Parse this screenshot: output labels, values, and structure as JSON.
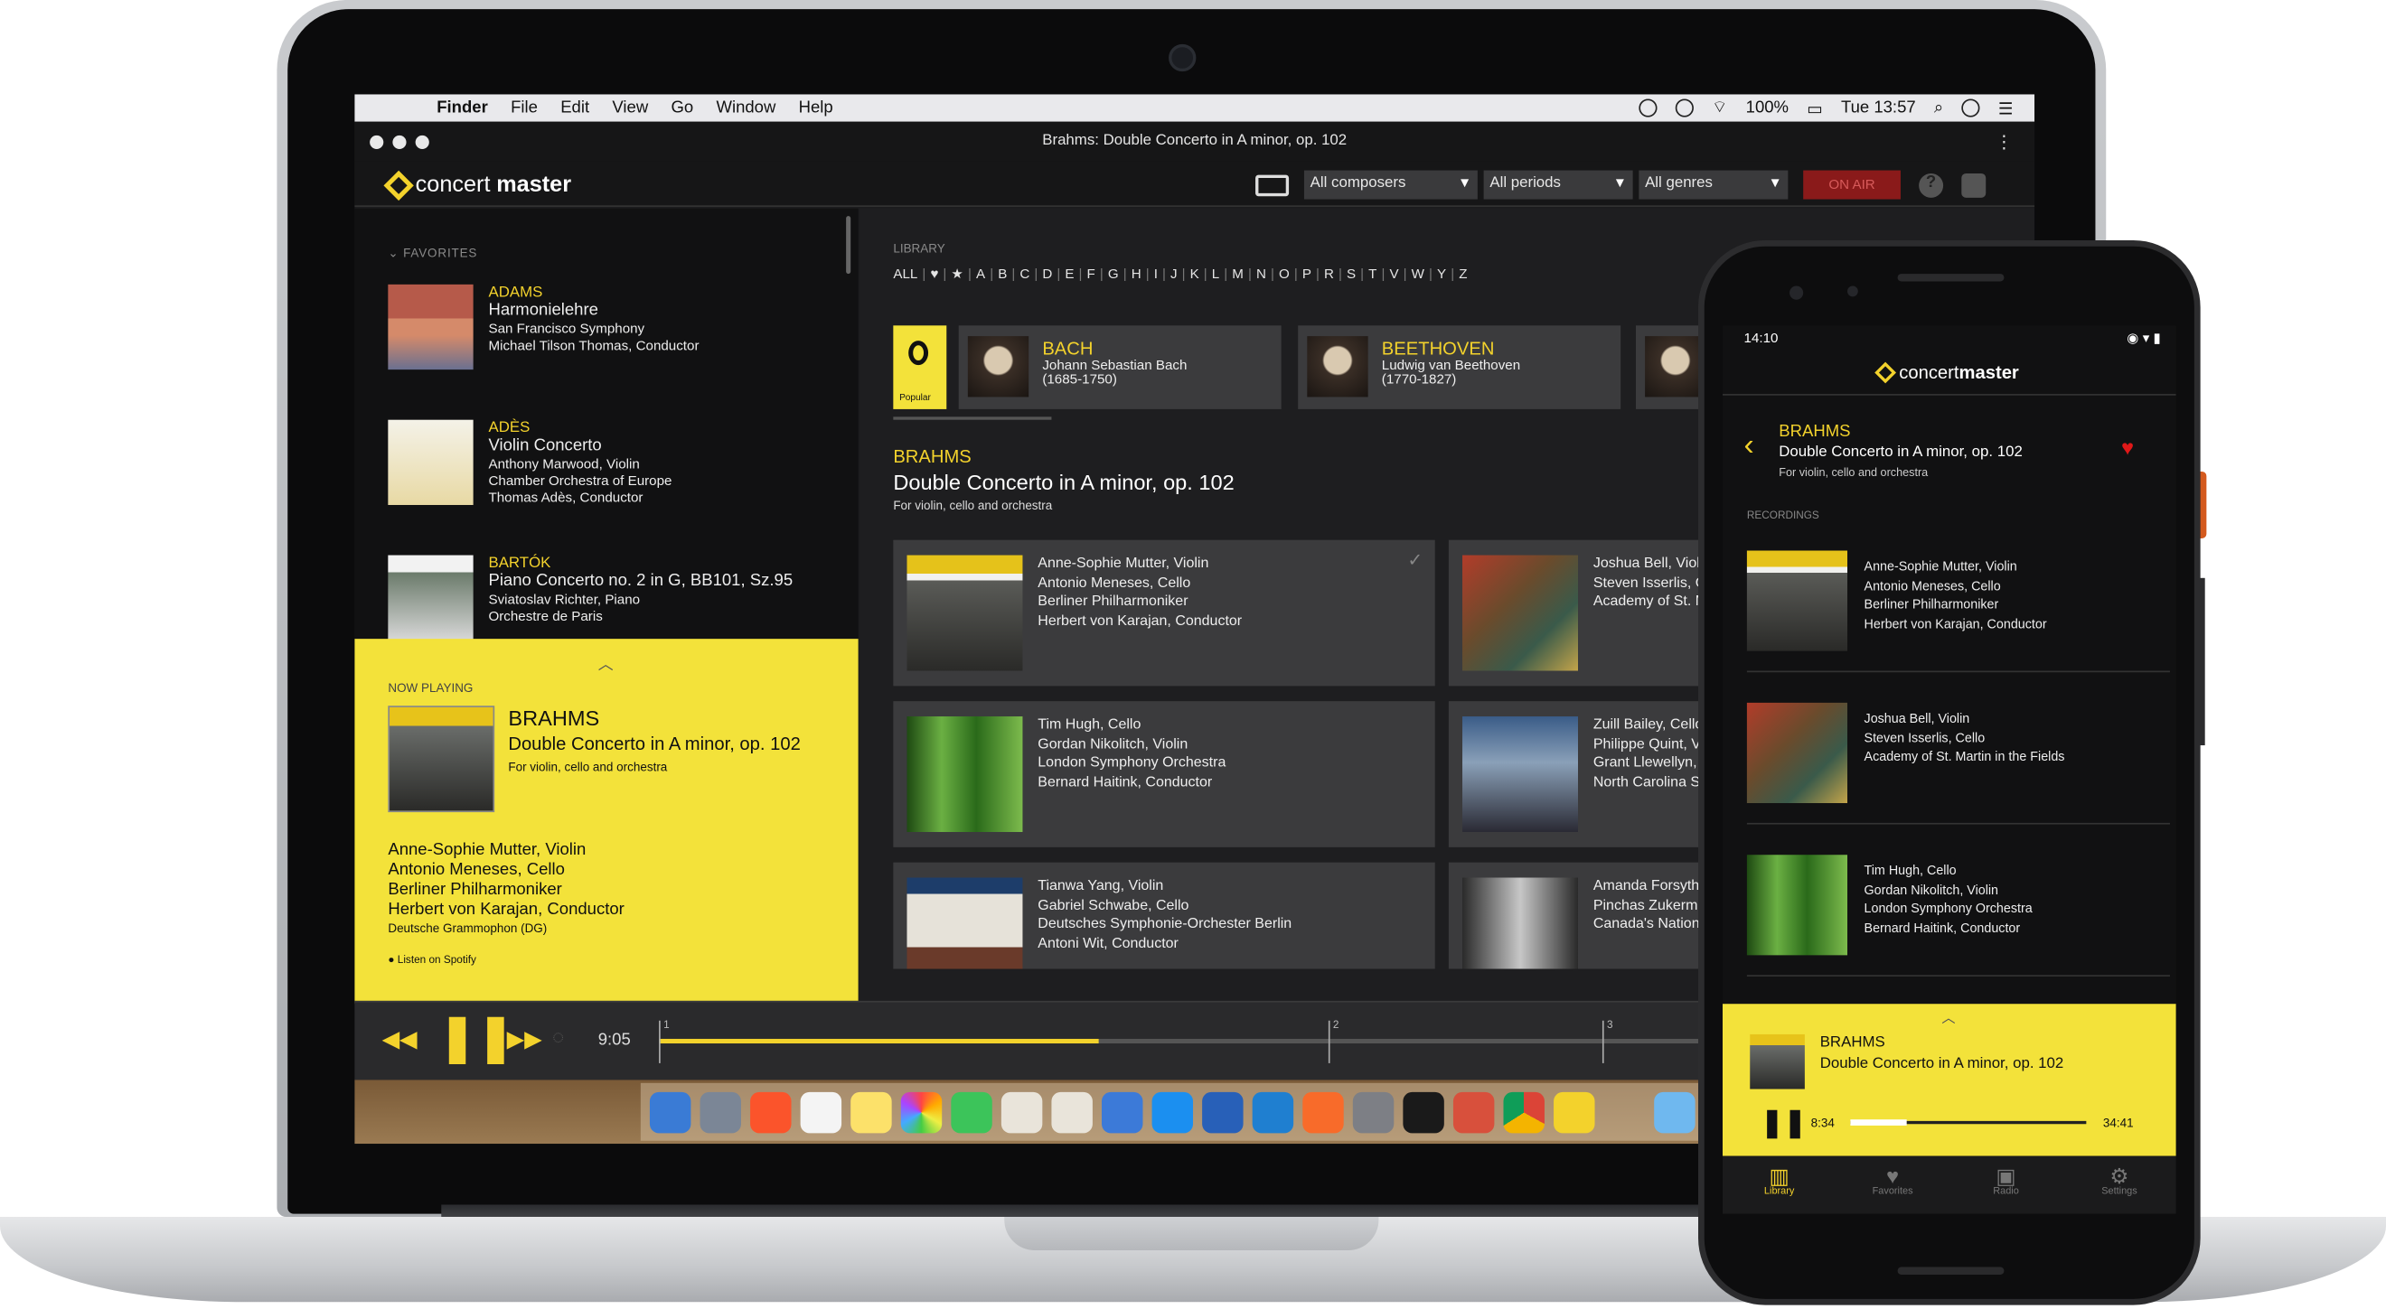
{
  "mac_menubar": {
    "items": [
      "Finder",
      "File",
      "Edit",
      "View",
      "Go",
      "Window",
      "Help"
    ],
    "battery": "100%",
    "clock": "Tue 13:57"
  },
  "window": {
    "title": "Brahms: Double Concerto in A minor, op. 102"
  },
  "app": {
    "logo_light": "concert",
    "logo_bold": "master",
    "filters": [
      "All composers",
      "All periods",
      "All genres"
    ],
    "on_air": "ON AIR",
    "help": "?"
  },
  "favorites": {
    "label": "FAVORITES",
    "items": [
      {
        "composer": "ADAMS",
        "work": "Harmonielehre",
        "performers": [
          "San Francisco Symphony",
          "Michael Tilson Thomas, Conductor"
        ]
      },
      {
        "composer": "ADÈS",
        "work": "Violin Concerto",
        "performers": [
          "Anthony Marwood, Violin",
          "Chamber Orchestra of Europe",
          "Thomas Adès, Conductor"
        ]
      },
      {
        "composer": "BARTÓK",
        "work": "Piano Concerto no. 2 in G, BB101, Sz.95",
        "performers": [
          "Sviatoslav Richter, Piano",
          "Orchestre de Paris"
        ]
      }
    ]
  },
  "now_playing": {
    "label": "NOW PLAYING",
    "composer": "BRAHMS",
    "work": "Double Concerto in A minor, op. 102",
    "subtitle": "For violin, cello and orchestra",
    "performers": [
      {
        "name": "Anne-Sophie Mutter",
        "role": ", Violin"
      },
      {
        "name": "Antonio Meneses",
        "role": ", Cello"
      },
      {
        "name": "Berliner Philharmoniker",
        "role": ""
      },
      {
        "name": "Herbert von Karajan",
        "role": ", Conductor"
      }
    ],
    "label_name": "Deutsche Grammophon (DG)",
    "spotify": "Listen on Spotify"
  },
  "player": {
    "time": "9:05",
    "progress_fraction": 0.32,
    "movements": [
      "1",
      "2",
      "3"
    ]
  },
  "library": {
    "label": "LIBRARY",
    "alphabet": [
      "ALL",
      "♥",
      "★",
      "A",
      "B",
      "C",
      "D",
      "E",
      "F",
      "G",
      "H",
      "I",
      "J",
      "K",
      "L",
      "M",
      "N",
      "O",
      "P",
      "R",
      "S",
      "T",
      "V",
      "W",
      "Y",
      "Z"
    ],
    "popular_label": "Popular",
    "composers": [
      {
        "name": "BACH",
        "full": "Johann Sebastian Bach",
        "dates": "(1685-1750)"
      },
      {
        "name": "BEETHOVEN",
        "full": "Ludwig van Beethoven",
        "dates": "(1770-1827)"
      }
    ],
    "work": {
      "composer": "BRAHMS",
      "title": "Double Concerto in A minor, op. 102",
      "subtitle": "For violin, cello and orchestra"
    },
    "recordings": [
      [
        "Anne-Sophie Mutter, Violin",
        "Antonio Meneses, Cello",
        "Berliner Philharmoniker",
        "Herbert von Karajan, Conductor"
      ],
      [
        "Joshua Bell, Violin",
        "Steven Isserlis, Cello",
        "Academy of St. M"
      ],
      [
        "Tim Hugh, Cello",
        "Gordan Nikolitch, Violin",
        "London Symphony Orchestra",
        "Bernard Haitink, Conductor"
      ],
      [
        "Zuill Bailey, Cello",
        "Philippe Quint, Vi",
        "Grant Llewellyn,",
        "North Carolina S"
      ],
      [
        "Tianwa Yang, Violin",
        "Gabriel Schwabe, Cello",
        "Deutsches Symphonie-Orchester Berlin",
        "Antoni Wit, Conductor"
      ],
      [
        "Amanda Forsyth",
        "Pinchas Zukerm",
        "Canada's Nation"
      ]
    ]
  },
  "phone": {
    "time": "14:10",
    "logo_light": "concert",
    "logo_bold": "master",
    "composer": "BRAHMS",
    "work": "Double Concerto in A minor, op. 102",
    "subtitle": "For violin, cello and orchestra",
    "recordings_label": "RECORDINGS",
    "recordings": [
      [
        "Anne-Sophie Mutter, Violin",
        "Antonio Meneses, Cello",
        "Berliner Philharmoniker",
        "Herbert von Karajan, Conductor"
      ],
      [
        "Joshua Bell, Violin",
        "Steven Isserlis, Cello",
        "Academy of St. Martin in the Fields"
      ],
      [
        "Tim Hugh, Cello",
        "Gordan Nikolitch, Violin",
        "London Symphony Orchestra",
        "Bernard Haitink, Conductor"
      ]
    ],
    "now_playing": {
      "composer": "BRAHMS",
      "work": "Double Concerto in A minor, op. 102",
      "elapsed": "8:34",
      "total": "34:41"
    },
    "tabs": [
      "Library",
      "Favorites",
      "Radio",
      "Settings"
    ]
  },
  "colors": {
    "accent": "#f3d22c",
    "panel": "#3b3b3d",
    "heart": "#e01818"
  }
}
